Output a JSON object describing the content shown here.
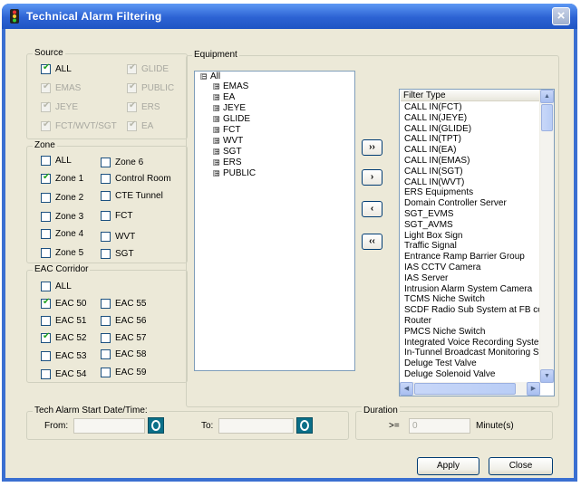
{
  "window": {
    "title": "Technical Alarm Filtering",
    "close_glyph": "×"
  },
  "source": {
    "title": "Source",
    "items": [
      {
        "label": "ALL",
        "checked": true,
        "enabled": true
      },
      {
        "label": "GLIDE",
        "checked": true,
        "enabled": false
      },
      {
        "label": "EMAS",
        "checked": true,
        "enabled": false
      },
      {
        "label": "PUBLIC",
        "checked": true,
        "enabled": false
      },
      {
        "label": "JEYE",
        "checked": true,
        "enabled": false
      },
      {
        "label": "ERS",
        "checked": true,
        "enabled": false
      },
      {
        "label": "FCT/WVT/SGT",
        "checked": true,
        "enabled": false
      },
      {
        "label": "EA",
        "checked": true,
        "enabled": false
      }
    ]
  },
  "zone": {
    "title": "Zone",
    "items": [
      {
        "label": "ALL",
        "checked": false
      },
      {
        "label": "Zone 6",
        "checked": false
      },
      {
        "label": "Zone 1",
        "checked": true
      },
      {
        "label": "Control Room",
        "checked": false
      },
      {
        "label": "Zone 2",
        "checked": false
      },
      {
        "label": "CTE Tunnel",
        "checked": false
      },
      {
        "label": "Zone 3",
        "checked": false
      },
      {
        "label": "FCT",
        "checked": false
      },
      {
        "label": "Zone 4",
        "checked": false
      },
      {
        "label": "WVT",
        "checked": false
      },
      {
        "label": "Zone 5",
        "checked": false
      },
      {
        "label": "SGT",
        "checked": false
      }
    ]
  },
  "eac": {
    "title": "EAC Corridor",
    "items": [
      {
        "label": "ALL",
        "checked": false
      },
      {
        "label": "EAC 50",
        "checked": true
      },
      {
        "label": "EAC 55",
        "checked": false
      },
      {
        "label": "EAC 51",
        "checked": false
      },
      {
        "label": "EAC 56",
        "checked": false
      },
      {
        "label": "EAC 52",
        "checked": true
      },
      {
        "label": "EAC 57",
        "checked": false
      },
      {
        "label": "EAC 53",
        "checked": false
      },
      {
        "label": "EAC 58",
        "checked": false
      },
      {
        "label": "EAC 54",
        "checked": false
      },
      {
        "label": "EAC 59",
        "checked": false
      }
    ]
  },
  "equipment": {
    "title": "Equipment",
    "root": {
      "label": "All",
      "expander": "⊟"
    },
    "children": [
      {
        "label": "EMAS",
        "expander": "⊞"
      },
      {
        "label": "EA",
        "expander": "⊞"
      },
      {
        "label": "JEYE",
        "expander": "⊞"
      },
      {
        "label": "GLIDE",
        "expander": "⊞"
      },
      {
        "label": "FCT",
        "expander": "⊞"
      },
      {
        "label": "WVT",
        "expander": "⊞"
      },
      {
        "label": "SGT",
        "expander": "⊞"
      },
      {
        "label": "ERS",
        "expander": "⊞"
      },
      {
        "label": "PUBLIC",
        "expander": "⊞"
      }
    ]
  },
  "move_buttons": {
    "add_all": "››",
    "add": "›",
    "remove": "‹",
    "remove_all": "‹‹"
  },
  "filter": {
    "header": "Filter Type",
    "items": [
      "CALL IN(FCT)",
      "CALL IN(JEYE)",
      "CALL IN(GLIDE)",
      "CALL IN(TPT)",
      "CALL IN(EA)",
      "CALL IN(EMAS)",
      "CALL IN(SGT)",
      "CALL IN(WVT)",
      "ERS Equipments",
      "Domain Controller Server",
      "SGT_EVMS",
      "SGT_AVMS",
      "Light Box Sign",
      "Traffic Signal",
      "Entrance Ramp Barrier Group",
      "IAS CCTV Camera",
      "IAS Server",
      "Intrusion Alarm System Camera",
      "TCMS Niche Switch",
      "SCDF Radio Sub System at FB contr",
      "Router",
      "PMCS Niche Switch",
      "Integrated Voice Recording System",
      "In-Tunnel Broadcast Monitoring Syste",
      "Deluge Test Valve",
      "Deluge Solenoid Valve"
    ],
    "scroll_up": "▲",
    "scroll_down": "▼",
    "scroll_left": "◀",
    "scroll_right": "▶"
  },
  "tech_alarm": {
    "title": "Tech Alarm Start Date/Time:",
    "from_label": "From:",
    "from_value": "",
    "to_label": "To:",
    "to_value": ""
  },
  "duration": {
    "title": "Duration",
    "operator": ">=",
    "value": "0",
    "unit": "Minute(s)"
  },
  "buttons": {
    "apply": "Apply",
    "close": "Close"
  },
  "colors": {
    "titlebar": "#2c62d3",
    "dialog_bg": "#ece9d8",
    "check": "#21a121"
  }
}
